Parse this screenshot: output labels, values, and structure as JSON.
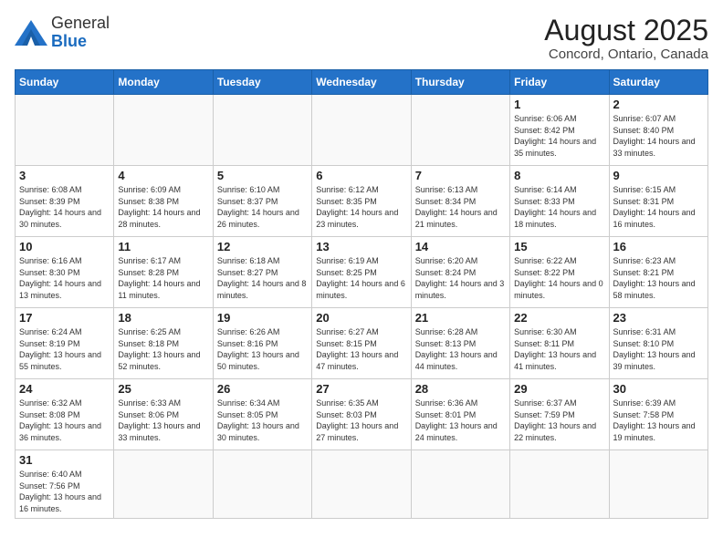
{
  "header": {
    "logo_text_general": "General",
    "logo_text_blue": "Blue",
    "month_year": "August 2025",
    "location": "Concord, Ontario, Canada"
  },
  "weekdays": [
    "Sunday",
    "Monday",
    "Tuesday",
    "Wednesday",
    "Thursday",
    "Friday",
    "Saturday"
  ],
  "weeks": [
    [
      {
        "day": "",
        "info": ""
      },
      {
        "day": "",
        "info": ""
      },
      {
        "day": "",
        "info": ""
      },
      {
        "day": "",
        "info": ""
      },
      {
        "day": "",
        "info": ""
      },
      {
        "day": "1",
        "info": "Sunrise: 6:06 AM\nSunset: 8:42 PM\nDaylight: 14 hours and 35 minutes."
      },
      {
        "day": "2",
        "info": "Sunrise: 6:07 AM\nSunset: 8:40 PM\nDaylight: 14 hours and 33 minutes."
      }
    ],
    [
      {
        "day": "3",
        "info": "Sunrise: 6:08 AM\nSunset: 8:39 PM\nDaylight: 14 hours and 30 minutes."
      },
      {
        "day": "4",
        "info": "Sunrise: 6:09 AM\nSunset: 8:38 PM\nDaylight: 14 hours and 28 minutes."
      },
      {
        "day": "5",
        "info": "Sunrise: 6:10 AM\nSunset: 8:37 PM\nDaylight: 14 hours and 26 minutes."
      },
      {
        "day": "6",
        "info": "Sunrise: 6:12 AM\nSunset: 8:35 PM\nDaylight: 14 hours and 23 minutes."
      },
      {
        "day": "7",
        "info": "Sunrise: 6:13 AM\nSunset: 8:34 PM\nDaylight: 14 hours and 21 minutes."
      },
      {
        "day": "8",
        "info": "Sunrise: 6:14 AM\nSunset: 8:33 PM\nDaylight: 14 hours and 18 minutes."
      },
      {
        "day": "9",
        "info": "Sunrise: 6:15 AM\nSunset: 8:31 PM\nDaylight: 14 hours and 16 minutes."
      }
    ],
    [
      {
        "day": "10",
        "info": "Sunrise: 6:16 AM\nSunset: 8:30 PM\nDaylight: 14 hours and 13 minutes."
      },
      {
        "day": "11",
        "info": "Sunrise: 6:17 AM\nSunset: 8:28 PM\nDaylight: 14 hours and 11 minutes."
      },
      {
        "day": "12",
        "info": "Sunrise: 6:18 AM\nSunset: 8:27 PM\nDaylight: 14 hours and 8 minutes."
      },
      {
        "day": "13",
        "info": "Sunrise: 6:19 AM\nSunset: 8:25 PM\nDaylight: 14 hours and 6 minutes."
      },
      {
        "day": "14",
        "info": "Sunrise: 6:20 AM\nSunset: 8:24 PM\nDaylight: 14 hours and 3 minutes."
      },
      {
        "day": "15",
        "info": "Sunrise: 6:22 AM\nSunset: 8:22 PM\nDaylight: 14 hours and 0 minutes."
      },
      {
        "day": "16",
        "info": "Sunrise: 6:23 AM\nSunset: 8:21 PM\nDaylight: 13 hours and 58 minutes."
      }
    ],
    [
      {
        "day": "17",
        "info": "Sunrise: 6:24 AM\nSunset: 8:19 PM\nDaylight: 13 hours and 55 minutes."
      },
      {
        "day": "18",
        "info": "Sunrise: 6:25 AM\nSunset: 8:18 PM\nDaylight: 13 hours and 52 minutes."
      },
      {
        "day": "19",
        "info": "Sunrise: 6:26 AM\nSunset: 8:16 PM\nDaylight: 13 hours and 50 minutes."
      },
      {
        "day": "20",
        "info": "Sunrise: 6:27 AM\nSunset: 8:15 PM\nDaylight: 13 hours and 47 minutes."
      },
      {
        "day": "21",
        "info": "Sunrise: 6:28 AM\nSunset: 8:13 PM\nDaylight: 13 hours and 44 minutes."
      },
      {
        "day": "22",
        "info": "Sunrise: 6:30 AM\nSunset: 8:11 PM\nDaylight: 13 hours and 41 minutes."
      },
      {
        "day": "23",
        "info": "Sunrise: 6:31 AM\nSunset: 8:10 PM\nDaylight: 13 hours and 39 minutes."
      }
    ],
    [
      {
        "day": "24",
        "info": "Sunrise: 6:32 AM\nSunset: 8:08 PM\nDaylight: 13 hours and 36 minutes."
      },
      {
        "day": "25",
        "info": "Sunrise: 6:33 AM\nSunset: 8:06 PM\nDaylight: 13 hours and 33 minutes."
      },
      {
        "day": "26",
        "info": "Sunrise: 6:34 AM\nSunset: 8:05 PM\nDaylight: 13 hours and 30 minutes."
      },
      {
        "day": "27",
        "info": "Sunrise: 6:35 AM\nSunset: 8:03 PM\nDaylight: 13 hours and 27 minutes."
      },
      {
        "day": "28",
        "info": "Sunrise: 6:36 AM\nSunset: 8:01 PM\nDaylight: 13 hours and 24 minutes."
      },
      {
        "day": "29",
        "info": "Sunrise: 6:37 AM\nSunset: 7:59 PM\nDaylight: 13 hours and 22 minutes."
      },
      {
        "day": "30",
        "info": "Sunrise: 6:39 AM\nSunset: 7:58 PM\nDaylight: 13 hours and 19 minutes."
      }
    ],
    [
      {
        "day": "31",
        "info": "Sunrise: 6:40 AM\nSunset: 7:56 PM\nDaylight: 13 hours and 16 minutes."
      },
      {
        "day": "",
        "info": ""
      },
      {
        "day": "",
        "info": ""
      },
      {
        "day": "",
        "info": ""
      },
      {
        "day": "",
        "info": ""
      },
      {
        "day": "",
        "info": ""
      },
      {
        "day": "",
        "info": ""
      }
    ]
  ]
}
